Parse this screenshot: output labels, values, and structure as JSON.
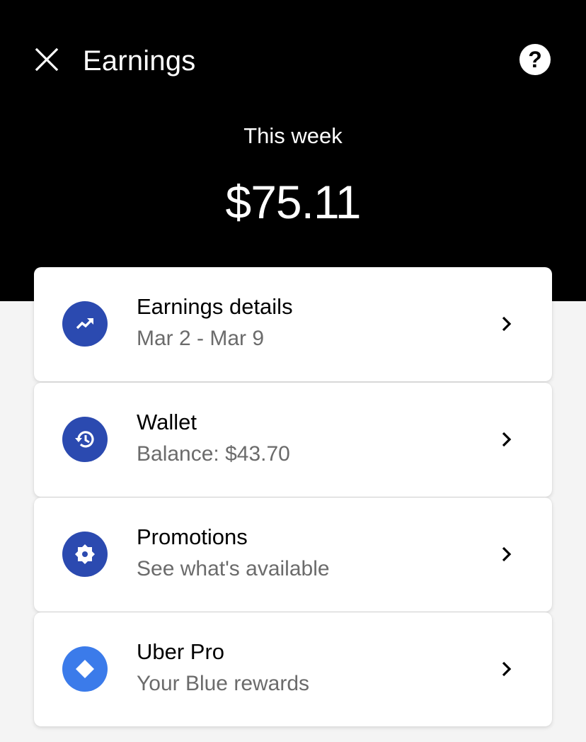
{
  "header": {
    "title": "Earnings",
    "close_icon": "close-icon",
    "help_icon": "question-mark-icon",
    "help_label": "?"
  },
  "summary": {
    "period_label": "This week",
    "amount": "$75.11"
  },
  "colors": {
    "hero_background": "#000000",
    "icon_navy": "#2b4ab0",
    "icon_blue": "#3b7bea",
    "subtitle_gray": "#6b6b6b"
  },
  "cards": [
    {
      "title": "Earnings details",
      "subtitle": "Mar 2 - Mar 9",
      "icon": "trending-up-icon"
    },
    {
      "title": "Wallet",
      "subtitle": "Balance: $43.70",
      "icon": "history-icon"
    },
    {
      "title": "Promotions",
      "subtitle": "See what's available",
      "icon": "promotion-badge-icon"
    },
    {
      "title": "Uber Pro",
      "subtitle": "Your Blue rewards",
      "icon": "diamond-icon"
    }
  ]
}
